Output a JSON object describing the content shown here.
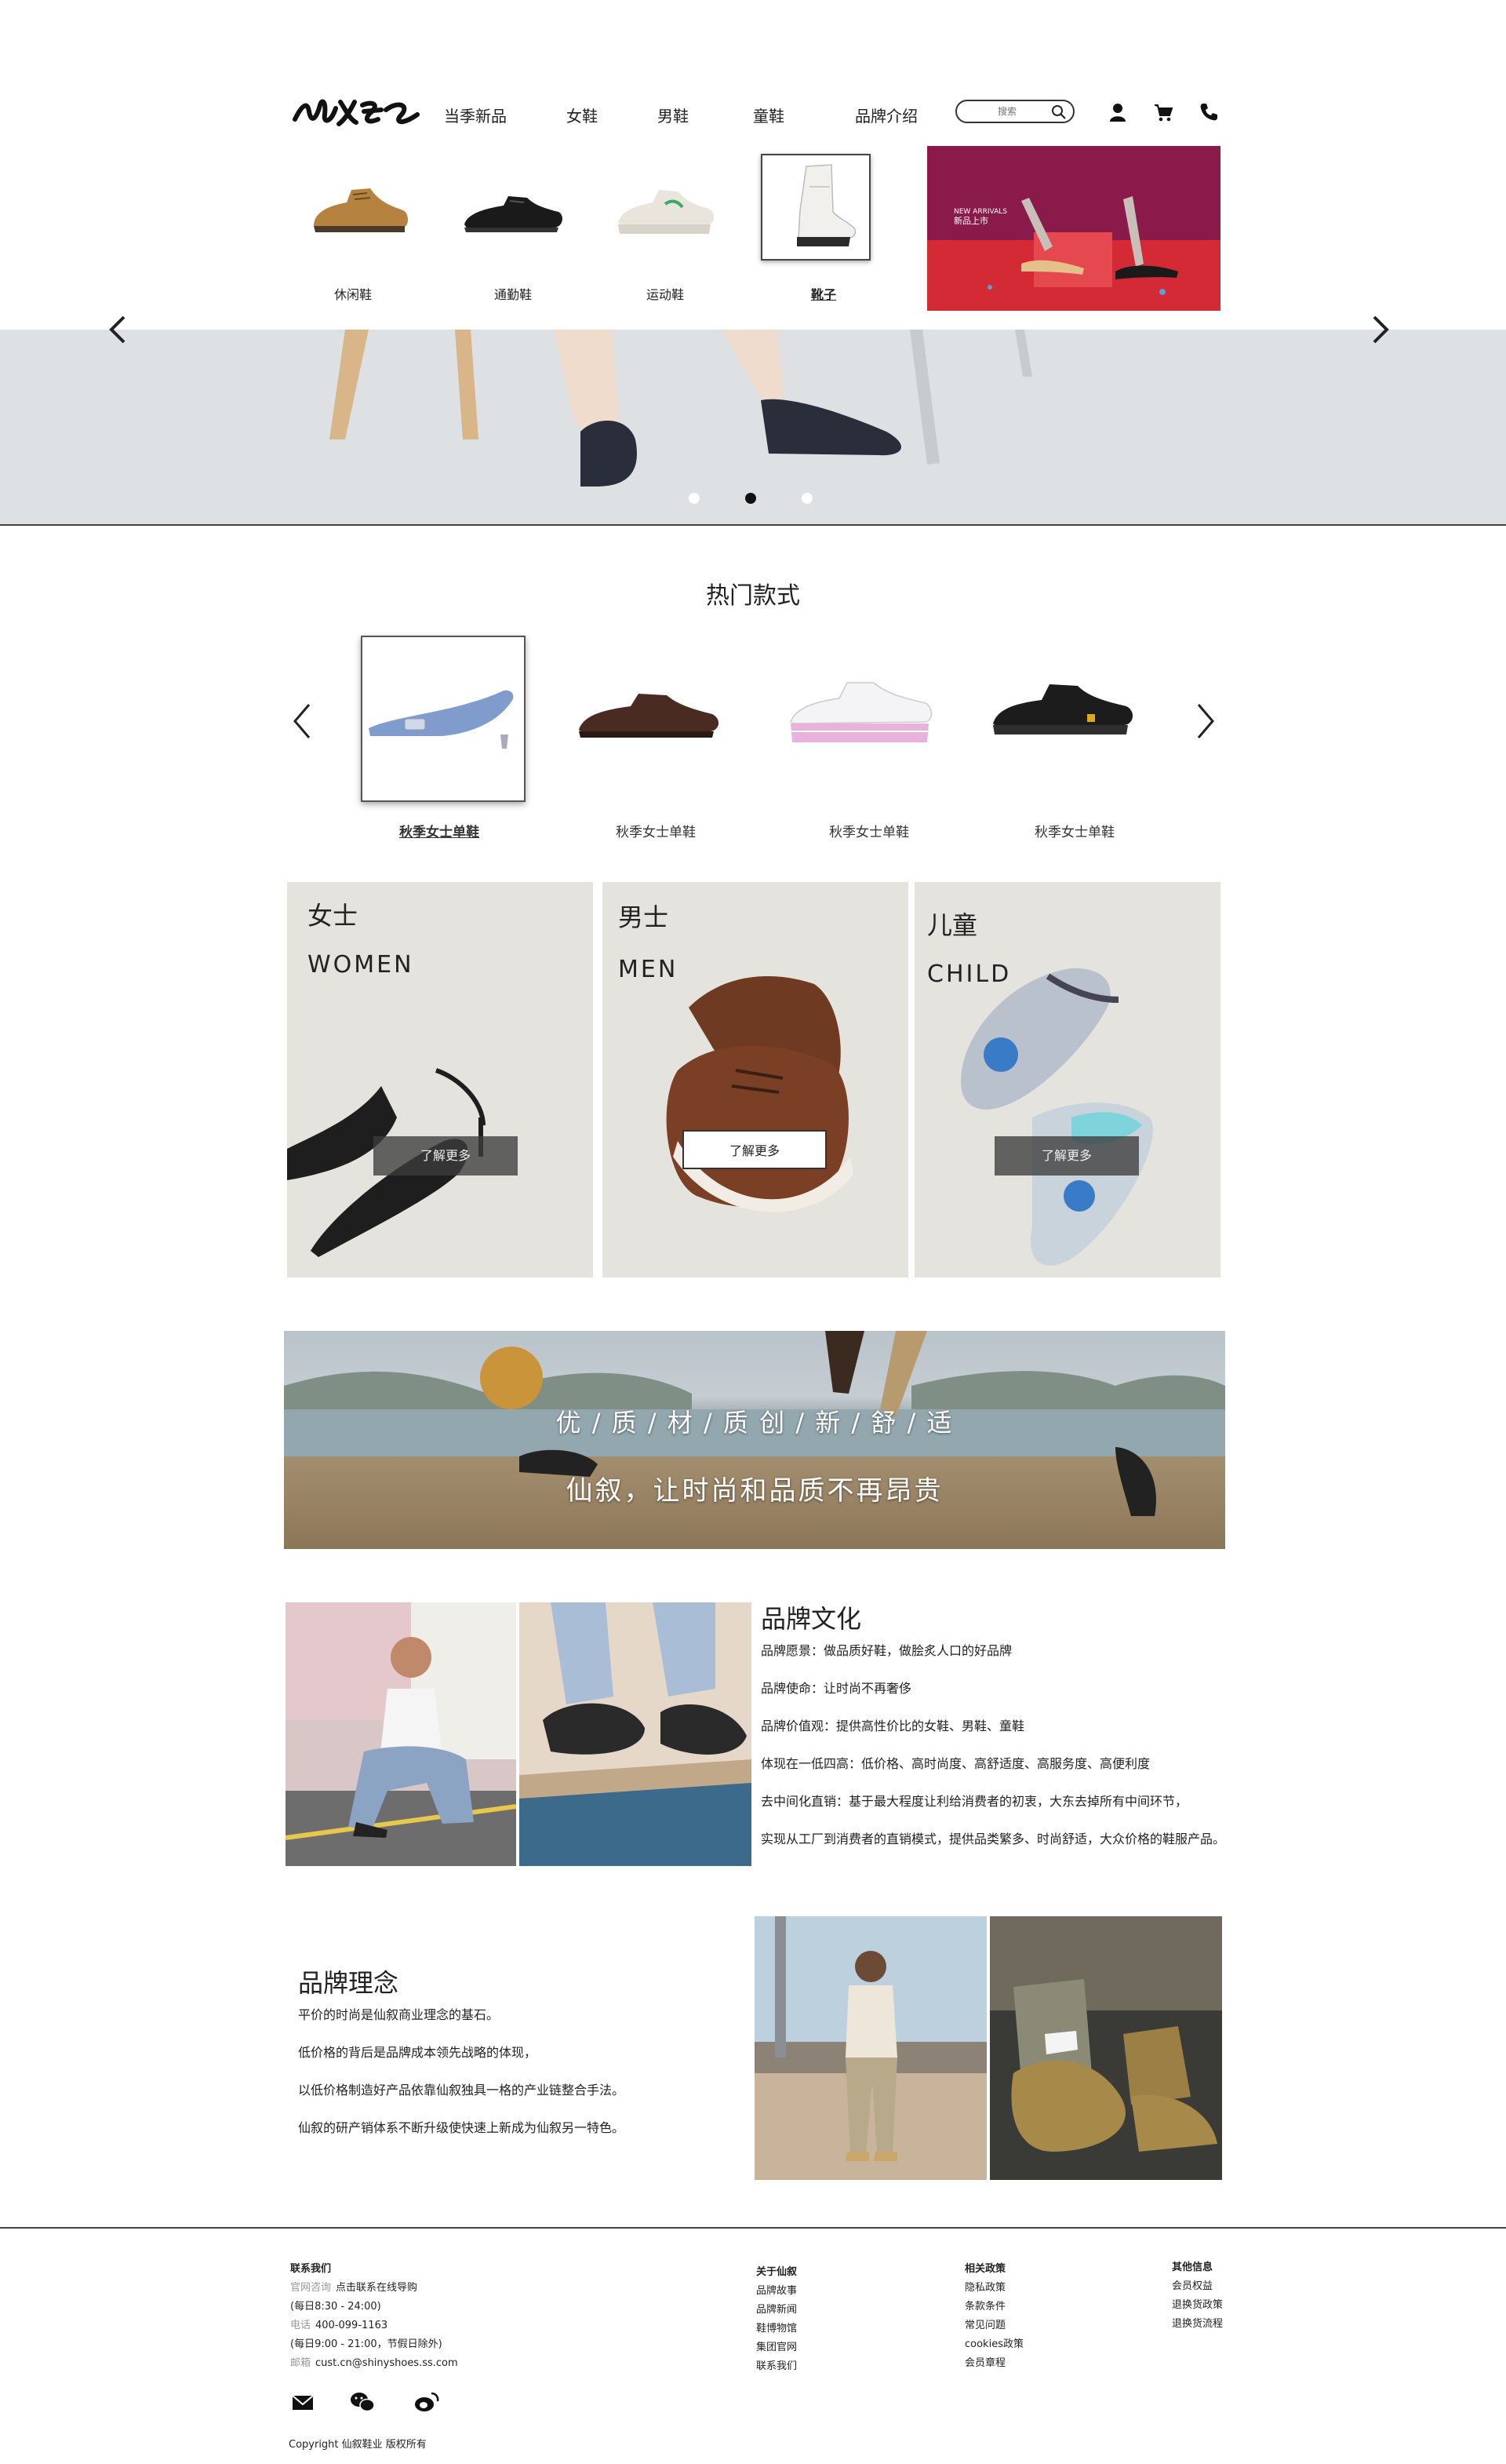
{
  "header": {
    "nav": [
      {
        "label": "当季新品",
        "name": "nav-new-season"
      },
      {
        "label": "女鞋",
        "name": "nav-women"
      },
      {
        "label": "男鞋",
        "name": "nav-men"
      },
      {
        "label": "童鞋",
        "name": "nav-kids"
      },
      {
        "label": "品牌介绍",
        "name": "nav-brand"
      }
    ],
    "search_placeholder": "搜索",
    "icons": [
      "user-icon",
      "cart-icon",
      "phone-icon"
    ]
  },
  "mega_menu": {
    "categories": [
      {
        "label": "休闲鞋",
        "icon": "casual-shoe"
      },
      {
        "label": "通勤鞋",
        "icon": "oxford-shoe"
      },
      {
        "label": "运动鞋",
        "icon": "sneaker"
      },
      {
        "label": "靴子",
        "icon": "boot",
        "active": true
      }
    ],
    "promo": {
      "line1": "NEW ARRIVALS",
      "line2": "新品上市"
    }
  },
  "hero": {
    "dots": 3,
    "active_dot": 2
  },
  "hot": {
    "title": "热门款式",
    "items": [
      {
        "label": "秋季女士单鞋",
        "icon": "blue-flat",
        "active": true
      },
      {
        "label": "秋季女士单鞋",
        "icon": "brown-oxford"
      },
      {
        "label": "秋季女士单鞋",
        "icon": "pink-sneaker"
      },
      {
        "label": "秋季女士单鞋",
        "icon": "black-sneaker"
      }
    ]
  },
  "panels": [
    {
      "cn": "女士",
      "en": "WOMEN",
      "button": "了解更多"
    },
    {
      "cn": "男士",
      "en": "MEN",
      "button": "了解更多"
    },
    {
      "cn": "儿童",
      "en": "CHILD",
      "button": "了解更多"
    }
  ],
  "banner": {
    "motto": "优 / 质 / 材 / 质      创 / 新 / 舒 / 适",
    "slogan": "仙叙，让时尚和品质不再昂贵"
  },
  "culture": {
    "title": "品牌文化",
    "lines": [
      "品牌愿景：做品质好鞋，做脍炙人口的好品牌",
      "品牌使命：让时尚不再奢侈",
      "品牌价值观：提供高性价比的女鞋、男鞋、童鞋",
      "体现在一低四高：低价格、高时尚度、高舒适度、高服务度、高便利度",
      "去中间化直销：基于最大程度让利给消费者的初衷，大东去掉所有中间环节，",
      "实现从工厂到消费者的直销模式，提供品类繁多、时尚舒适，大众价格的鞋服产品。"
    ]
  },
  "concept": {
    "title": "品牌理念",
    "lines": [
      "平价的时尚是仙叙商业理念的基石。",
      "低价格的背后是品牌成本领先战略的体现，",
      "以低价格制造好产品依靠仙叙独具一格的产业链整合手法。",
      "仙叙的研产销体系不断升级使快速上新成为仙叙另一特色。"
    ]
  },
  "footer": {
    "contact": {
      "title": "联系我们",
      "lines": [
        {
          "label": "官网咨询",
          "value": "点击联系在线导购"
        },
        {
          "label": "",
          "value": "(每日8:30 - 24:00)"
        },
        {
          "label": "电话",
          "value": "400-099-1163"
        },
        {
          "label": "",
          "value": "(每日9:00 - 21:00，节假日除外)"
        },
        {
          "label": "邮箱",
          "value": "cust.cn@shinyshoes.ss.com"
        }
      ]
    },
    "about": {
      "title": "关于仙叙",
      "links": [
        "品牌故事",
        "品牌新闻",
        "鞋博物馆",
        "集团官网",
        "联系我们"
      ]
    },
    "policy": {
      "title": "相关政策",
      "links": [
        "隐私政策",
        "条款条件",
        "常见问题",
        "cookies政策",
        "会员章程"
      ]
    },
    "other": {
      "title": "其他信息",
      "links": [
        "会员权益",
        "退换货政策",
        "退换货流程"
      ]
    },
    "social": [
      "mail-icon",
      "wechat-icon",
      "weibo-icon"
    ],
    "copyright": "Copyright 仙叙鞋业 版权所有"
  }
}
